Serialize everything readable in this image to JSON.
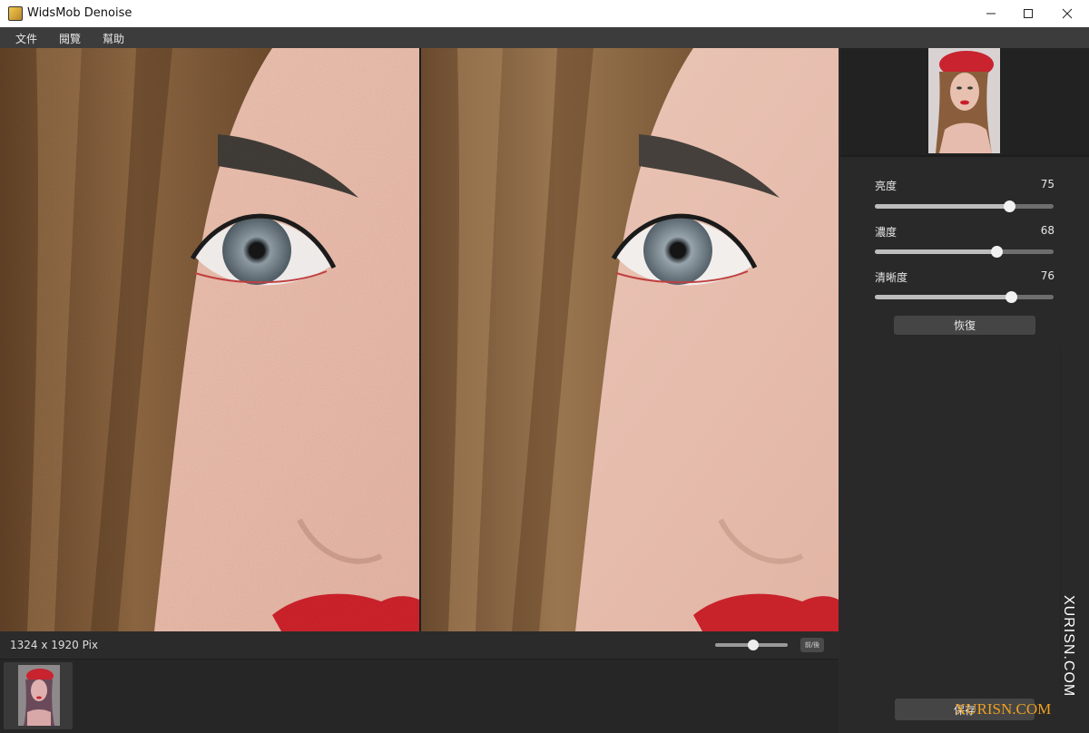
{
  "window": {
    "title": "WidsMob Denoise"
  },
  "menu": {
    "items": [
      "文件",
      "閱覽",
      "幫助"
    ]
  },
  "status": {
    "dimensions": "1324 x 1920 Pix",
    "zoom_level": 0.53,
    "before_after_label": "前/後"
  },
  "adjustments": {
    "sliders": [
      {
        "label": "亮度",
        "value": "75",
        "level": 0.75
      },
      {
        "label": "濃度",
        "value": "68",
        "level": 0.68
      },
      {
        "label": "清晰度",
        "value": "76",
        "level": 0.76
      }
    ],
    "reset_label": "恢復",
    "save_label": "保存"
  },
  "watermark": {
    "vertical_text": "XURISN.COM",
    "overlay_text": "XURISN.COM"
  },
  "colors": {
    "accent_lip": "#c8202a",
    "panel_bg": "#292929",
    "hat_red": "#c8232f"
  }
}
